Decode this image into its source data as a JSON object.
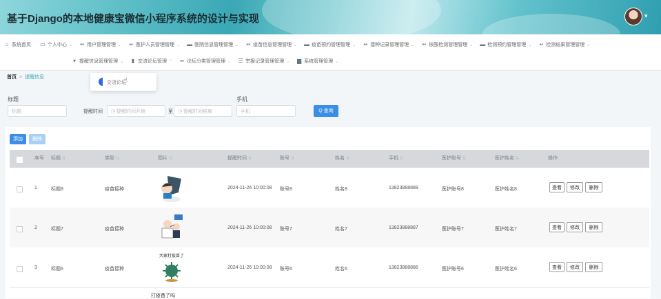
{
  "header": {
    "title": "基于Django的本地健康宝微信小程序系统的设计与实现",
    "avatar": "user-avatar",
    "caret": "▾"
  },
  "nav": {
    "row1": [
      {
        "icon": "home-icon",
        "glyph": "⌂",
        "label": "系统首页",
        "caret": ""
      },
      {
        "icon": "user-icon",
        "glyph": "▭",
        "label": "个人中心",
        "caret": "⌄"
      },
      {
        "icon": "grid-icon",
        "glyph": "▪▪",
        "label": "用户管理管理",
        "caret": "⌄"
      },
      {
        "icon": "grid-icon",
        "glyph": "▪▪",
        "label": "医护人员管理管理",
        "caret": "⌄"
      },
      {
        "icon": "grid-icon",
        "glyph": "▬",
        "label": "医院信息管理管理",
        "caret": "⌄"
      },
      {
        "icon": "grid-icon",
        "glyph": "▪▪",
        "label": "疫苗信息管理管理",
        "caret": "⌄"
      },
      {
        "icon": "grid-icon",
        "glyph": "▬",
        "label": "疫苗预约管理管理",
        "caret": "⌄"
      },
      {
        "icon": "grid-icon",
        "glyph": "▪▪",
        "label": "接种记录管理管理",
        "caret": "⌄"
      },
      {
        "icon": "grid-icon",
        "glyph": "▪▪",
        "label": "核酸检测管理管理",
        "caret": "⌄"
      },
      {
        "icon": "grid-icon",
        "glyph": "▬",
        "label": "检测预约管理管理",
        "caret": "⌄"
      },
      {
        "icon": "grid-icon",
        "glyph": "▪▪",
        "label": "检测结果管理管理",
        "caret": "⌄"
      }
    ],
    "row2": [
      {
        "icon": "pin-icon",
        "glyph": "▾",
        "label": "提醒信息管理管理",
        "caret": "⌄"
      },
      {
        "icon": "chart-icon",
        "glyph": "▮",
        "label": "交流论坛管理",
        "caret": "⌃"
      },
      {
        "icon": "grid-icon",
        "glyph": "▪▪",
        "label": "论坛分类管理管理",
        "caret": "⌄"
      },
      {
        "icon": "list-icon",
        "glyph": "☰",
        "label": "举报记录管理管理",
        "caret": "⌄"
      },
      {
        "icon": "trash-icon",
        "glyph": "▆",
        "label": "系统管理管理",
        "caret": "⌄"
      }
    ]
  },
  "breadcrumb": {
    "home": "首页",
    "sep": ">",
    "current": "提醒信息"
  },
  "dropdown": {
    "item": "交流论坛",
    "cursor": "☝"
  },
  "search": {
    "title_label": "标题",
    "title_placeholder": "标题",
    "time_label": "提醒时间",
    "time_start": "◷ 提醒时间开始",
    "to": "至",
    "time_end": "◷ 提醒时间结束",
    "phone_label": "手机",
    "phone_placeholder": "手机",
    "button": "Q 查询"
  },
  "toolbar": {
    "add": "添加",
    "delete": "删除"
  },
  "table": {
    "columns": [
      "序号",
      "标题",
      "类型",
      "图片",
      "提醒时间",
      "账号",
      "姓名",
      "手机",
      "医护账号",
      "医护姓名",
      "操作"
    ],
    "sort_arrow": "⇅",
    "rows": [
      {
        "index": "1",
        "title": "标题8",
        "type": "疫苗接种",
        "image": "cartoon-vaccine-shield",
        "time": "2024-11-26 10:00:08",
        "account": "账号8",
        "name": "姓名8",
        "phone": "13823888888",
        "staff_account": "医护账号8",
        "staff_name": "医护姓名8"
      },
      {
        "index": "2",
        "title": "标题7",
        "type": "疫苗接种",
        "image": "cartoon-doctor-injection",
        "time": "2024-11-26 10:00:08",
        "account": "账号7",
        "name": "姓名7",
        "phone": "13823888887",
        "staff_account": "医护账号7",
        "staff_name": "医护姓名7"
      },
      {
        "index": "3",
        "title": "标题6",
        "type": "疫苗接种",
        "image": "cartoon-virus",
        "time": "2024-11-26 10:00:08",
        "account": "账号6",
        "name": "姓名6",
        "phone": "13823888886",
        "staff_account": "医护账号6",
        "staff_name": "医护姓名6"
      }
    ],
    "actions": {
      "view": "查看",
      "edit": "修改",
      "delete": "删除"
    },
    "caption_row3": "大家打疫苗了",
    "caption_row4": "打疫苗了吗"
  }
}
